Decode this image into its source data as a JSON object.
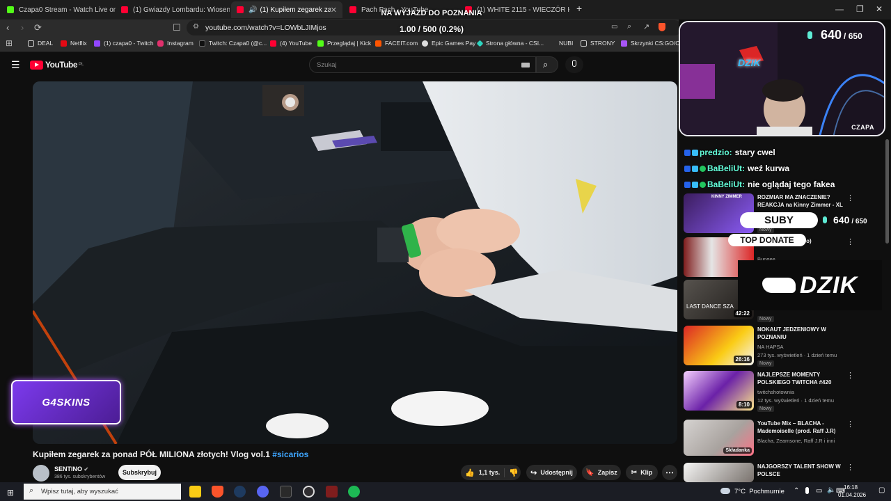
{
  "browser": {
    "tabs": [
      {
        "title": "Czapa0 Stream - Watch Live on Kick",
        "color": "#53fc18"
      },
      {
        "title": "(1) Gwiazdy Lombardu: Wiosenny Ol",
        "color": "#ff0033"
      },
      {
        "title": "(1) Kupiłem zegarek za ponad",
        "color": "#ff0033"
      },
      {
        "title": "Pach Pach - YouTube",
        "color": "#ff0033"
      },
      {
        "title": "(1) WHITE 2115 - WIECZÓR KAWALE",
        "color": "#ff0033"
      }
    ],
    "url": "youtube.com/watch?v=LOWbLJIMjos",
    "bookmarks": [
      "DEAL",
      "Netflix",
      "(1) czapa0 - Twitch",
      "Instagram",
      "Twitch: Czapa0 (@c...",
      "(4) YouTube",
      "Przeglądaj | Kick",
      "FACEIT.com",
      "Epic Games Pay",
      "Strona główna - CSI...",
      "NUBI",
      "STRONY",
      "Skrzynki CS:GO/CS2"
    ]
  },
  "overlay": {
    "goal_title": "NA WYJAZD DO POZNANIA",
    "goal_progress": "1.00 / 500 (0.2%)",
    "follower_count": "640",
    "follower_goal": "/ 650",
    "cam_label": "CZAPA",
    "brand": "DZIK",
    "sponsor": "G4SKINS",
    "subs_label": "SUBY",
    "subs_count": "640",
    "subs_goal": "/ 650",
    "top_donate": "TOP DONATE",
    "chat": [
      {
        "user": "predzio:",
        "text": "stary cwel"
      },
      {
        "user": "BaBeliUt:",
        "text": "weź kurwa"
      },
      {
        "user": "BaBeliUt:",
        "text": "nie oglądaj tego fakea"
      }
    ]
  },
  "youtube": {
    "logo": "YouTube",
    "logo_region": "PL",
    "search_placeholder": "Szukaj",
    "video_title": "Kupiłem zegarek za ponad PÓŁ MILIONA złotych! Vlog vol.1",
    "video_tag": "#sicarios",
    "channel": "SENTINO",
    "subscribers": "386 tys. subskrybentów",
    "subscribe": "Subskrybuj",
    "likes": "1,1 tys.",
    "share": "Udostępnij",
    "save": "Zapisz",
    "clip": "Klip",
    "recommendations": [
      {
        "title": "ROZMIAR MA ZNACZENIE? REAKCJA na Kinny Zimmer - XL",
        "channel": "",
        "meta": "",
        "badge": "Nowy",
        "duration": "",
        "thumb_text": "KINNY ZIMMER"
      },
      {
        "title": "... ficial Video)",
        "channel": "Bungee",
        "meta": "",
        "badge": "",
        "duration": ""
      },
      {
        "title": "",
        "channel": "",
        "meta": "",
        "badge": "Nowy",
        "duration": "42:22",
        "thumb_text": "LAST DANCE SZA"
      },
      {
        "title": "NOKAUT JEDZENIOWY W POZNANIU",
        "channel": "NA HAPSA",
        "meta": "273 tys. wyświetleń · 1 dzień temu",
        "badge": "Nowy",
        "duration": "26:16"
      },
      {
        "title": "NAJLEPSZE MOMENTY POLSKIEGO TWITCHA #420",
        "channel": "twitchshotownia",
        "meta": "12 tys. wyświetleń · 1 dzień temu",
        "badge": "Nowy",
        "duration": "8:10"
      },
      {
        "title": "YouTube Mix – BLACHA - Mademoiselle (prod. Raff J.R)",
        "channel": "Blacha, Zeamsone, Raff J.R i inni",
        "meta": "",
        "badge": "",
        "duration": "",
        "thumb_text": "Składanka"
      },
      {
        "title": "NAJGORSZY TALENT SHOW W POLSCE",
        "channel": "",
        "meta": "",
        "badge": "",
        "duration": ""
      }
    ]
  },
  "taskbar": {
    "search_placeholder": "Wpisz tutaj, aby wyszukać",
    "weather": "7°C  Pochmurnie",
    "time": "16:18",
    "date": "01.04.2026"
  }
}
